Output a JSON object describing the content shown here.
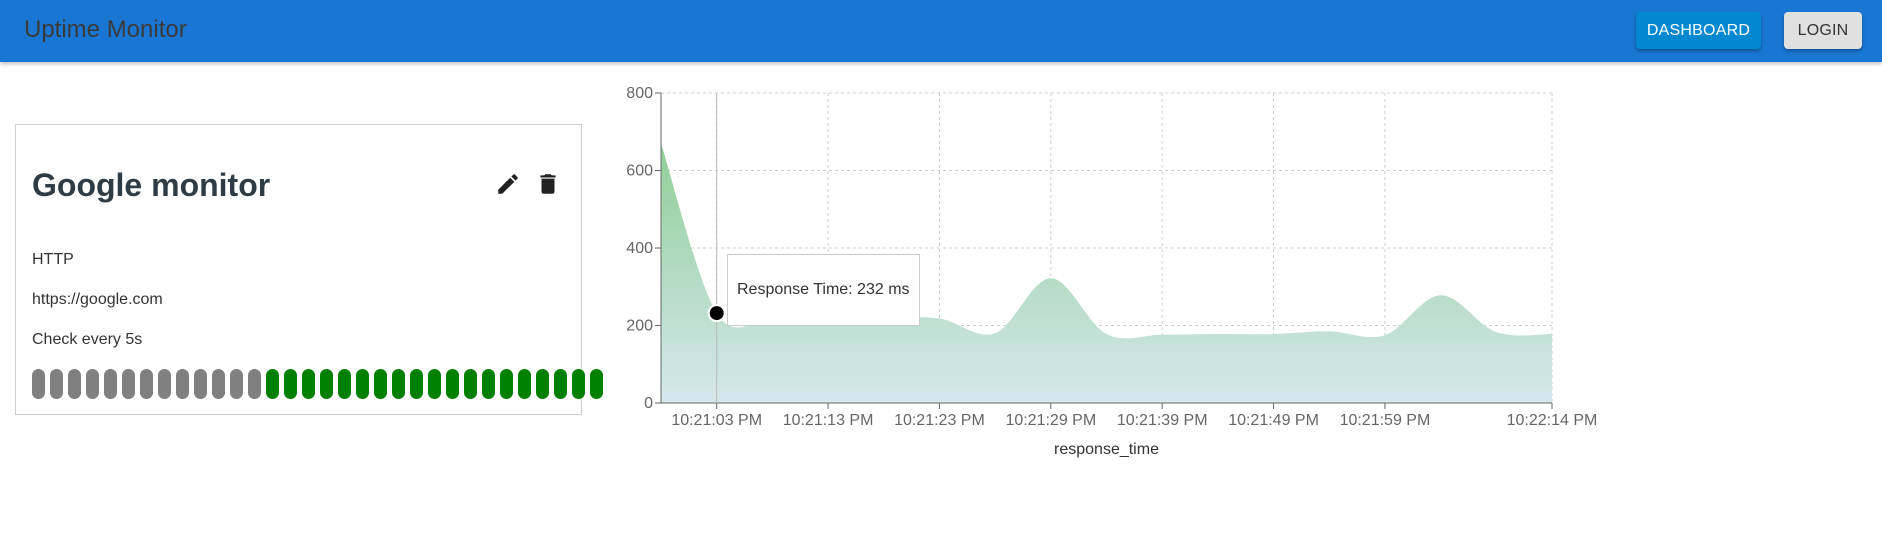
{
  "header": {
    "title": "Uptime Monitor",
    "dashboard_label": "DASHBOARD",
    "login_label": "LOGIN",
    "bar_color": "#1976d2"
  },
  "monitor": {
    "name": "Google monitor",
    "type": "HTTP",
    "url": "https://google.com",
    "interval": "Check every 5s",
    "heartbeats": [
      "down",
      "down",
      "down",
      "down",
      "down",
      "down",
      "down",
      "down",
      "down",
      "down",
      "down",
      "down",
      "down",
      "up",
      "up",
      "up",
      "up",
      "up",
      "up",
      "up",
      "up",
      "up",
      "up",
      "up",
      "up",
      "up",
      "up",
      "up",
      "up",
      "up",
      "up",
      "up"
    ],
    "heartbeat_colors": {
      "down": "#808080",
      "up": "#008000"
    },
    "icons": {
      "edit": "pencil-icon",
      "delete": "trash-icon"
    }
  },
  "tooltip": {
    "text": "Response Time: 232 ms"
  },
  "chart_data": {
    "type": "area",
    "xlabel": "response_time",
    "ylim": [
      0,
      800
    ],
    "yticks": [
      0,
      200,
      400,
      600,
      800
    ],
    "xlim_seconds": [
      0,
      80
    ],
    "xticks": [
      {
        "label": "10:21:03 PM",
        "t": 5
      },
      {
        "label": "10:21:13 PM",
        "t": 15
      },
      {
        "label": "10:21:23 PM",
        "t": 25
      },
      {
        "label": "10:21:29 PM",
        "t": 35
      },
      {
        "label": "10:21:39 PM",
        "t": 45
      },
      {
        "label": "10:21:49 PM",
        "t": 55
      },
      {
        "label": "10:21:59 PM",
        "t": 65
      },
      {
        "label": "10:22:14 PM",
        "t": 80
      }
    ],
    "grid": true,
    "series": [
      {
        "points": [
          {
            "t": 0,
            "v": 670
          },
          {
            "t": 5,
            "v": 232
          },
          {
            "t": 10,
            "v": 218
          },
          {
            "t": 15,
            "v": 216
          },
          {
            "t": 20,
            "v": 220
          },
          {
            "t": 25,
            "v": 218
          },
          {
            "t": 30,
            "v": 180
          },
          {
            "t": 35,
            "v": 322
          },
          {
            "t": 40,
            "v": 178
          },
          {
            "t": 45,
            "v": 176
          },
          {
            "t": 50,
            "v": 178
          },
          {
            "t": 55,
            "v": 178
          },
          {
            "t": 60,
            "v": 185
          },
          {
            "t": 65,
            "v": 175
          },
          {
            "t": 70,
            "v": 278
          },
          {
            "t": 75,
            "v": 183
          },
          {
            "t": 80,
            "v": 178
          }
        ]
      }
    ],
    "highlight": {
      "t": 5,
      "v": 232
    },
    "fill_color_top": "#8fcf97",
    "fill_color_bottom": "#d6e7ed"
  }
}
